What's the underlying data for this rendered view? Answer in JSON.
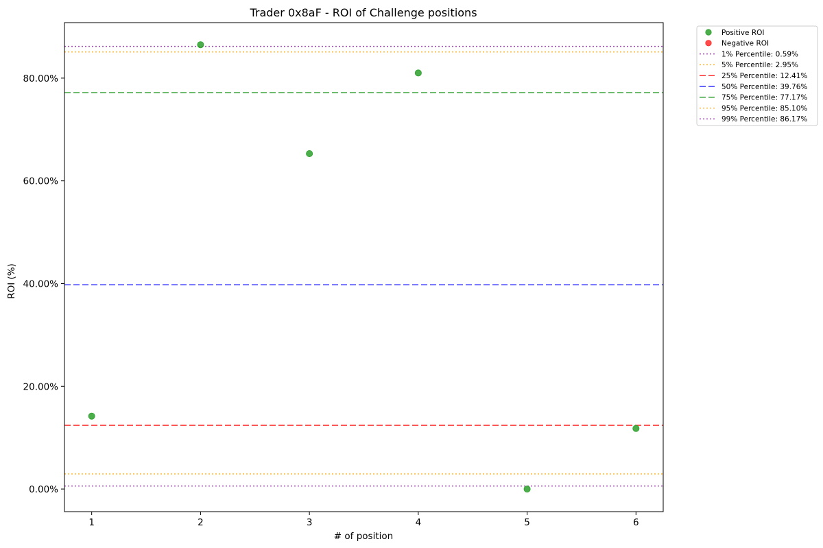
{
  "chart_data": {
    "type": "scatter",
    "title": "Trader 0x8aF - ROI of Challenge positions",
    "xlabel": "# of position",
    "ylabel": "ROI (%)",
    "xlim": [
      0.75,
      6.25
    ],
    "ylim": [
      -4.4,
      90.8
    ],
    "xticks": [
      1,
      2,
      3,
      4,
      5,
      6
    ],
    "xtick_labels": [
      "1",
      "2",
      "3",
      "4",
      "5",
      "6"
    ],
    "yticks": [
      0,
      20,
      40,
      60,
      80
    ],
    "ytick_labels": [
      "0.00%",
      "20.00%",
      "40.00%",
      "60.00%",
      "80.00%"
    ],
    "grid": false,
    "legend_position": "outside-top-right",
    "series": [
      {
        "name": "Positive ROI",
        "color": "#2ca02c",
        "points": [
          {
            "x": 1,
            "y": 14.2
          },
          {
            "x": 2,
            "y": 86.5
          },
          {
            "x": 3,
            "y": 65.3
          },
          {
            "x": 4,
            "y": 81.0
          },
          {
            "x": 5,
            "y": 0.0
          },
          {
            "x": 6,
            "y": 11.8
          }
        ]
      },
      {
        "name": "Negative ROI",
        "color": "#ff2a2a",
        "points": []
      }
    ],
    "reference_lines": [
      {
        "label": "1% Percentile: 0.59%",
        "value": 0.59,
        "color": "#a347b5",
        "style": "dotted"
      },
      {
        "label": "5% Percentile: 2.95%",
        "value": 2.95,
        "color": "#ffb833",
        "style": "dotted"
      },
      {
        "label": "25% Percentile: 12.41%",
        "value": 12.41,
        "color": "#ff3333",
        "style": "dashed"
      },
      {
        "label": "50% Percentile: 39.76%",
        "value": 39.76,
        "color": "#3333ff",
        "style": "dashed"
      },
      {
        "label": "75% Percentile: 77.17%",
        "value": 77.17,
        "color": "#33a033",
        "style": "dashed"
      },
      {
        "label": "95% Percentile: 85.10%",
        "value": 85.1,
        "color": "#ffb833",
        "style": "dotted"
      },
      {
        "label": "99% Percentile: 86.17%",
        "value": 86.17,
        "color": "#a347b5",
        "style": "dotted"
      }
    ]
  }
}
